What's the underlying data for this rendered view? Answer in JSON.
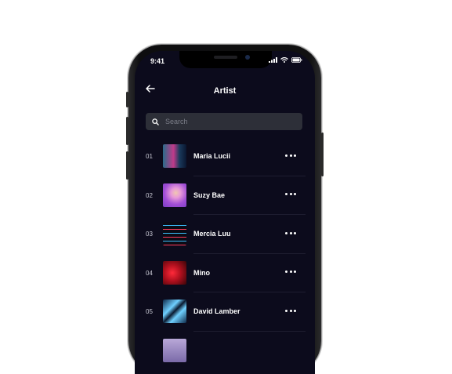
{
  "status_bar": {
    "time": "9:41"
  },
  "header": {
    "title": "Artist"
  },
  "search": {
    "placeholder": "Search"
  },
  "artists": [
    {
      "number": "01",
      "name": "Maria Lucii"
    },
    {
      "number": "02",
      "name": "Suzy Bae"
    },
    {
      "number": "03",
      "name": "Mercia Luu"
    },
    {
      "number": "04",
      "name": "Mino"
    },
    {
      "number": "05",
      "name": "David Lamber"
    }
  ],
  "colors": {
    "screen_background": "#0c0b1c",
    "search_background": "#2d2f38",
    "text_primary": "#ffffff"
  }
}
